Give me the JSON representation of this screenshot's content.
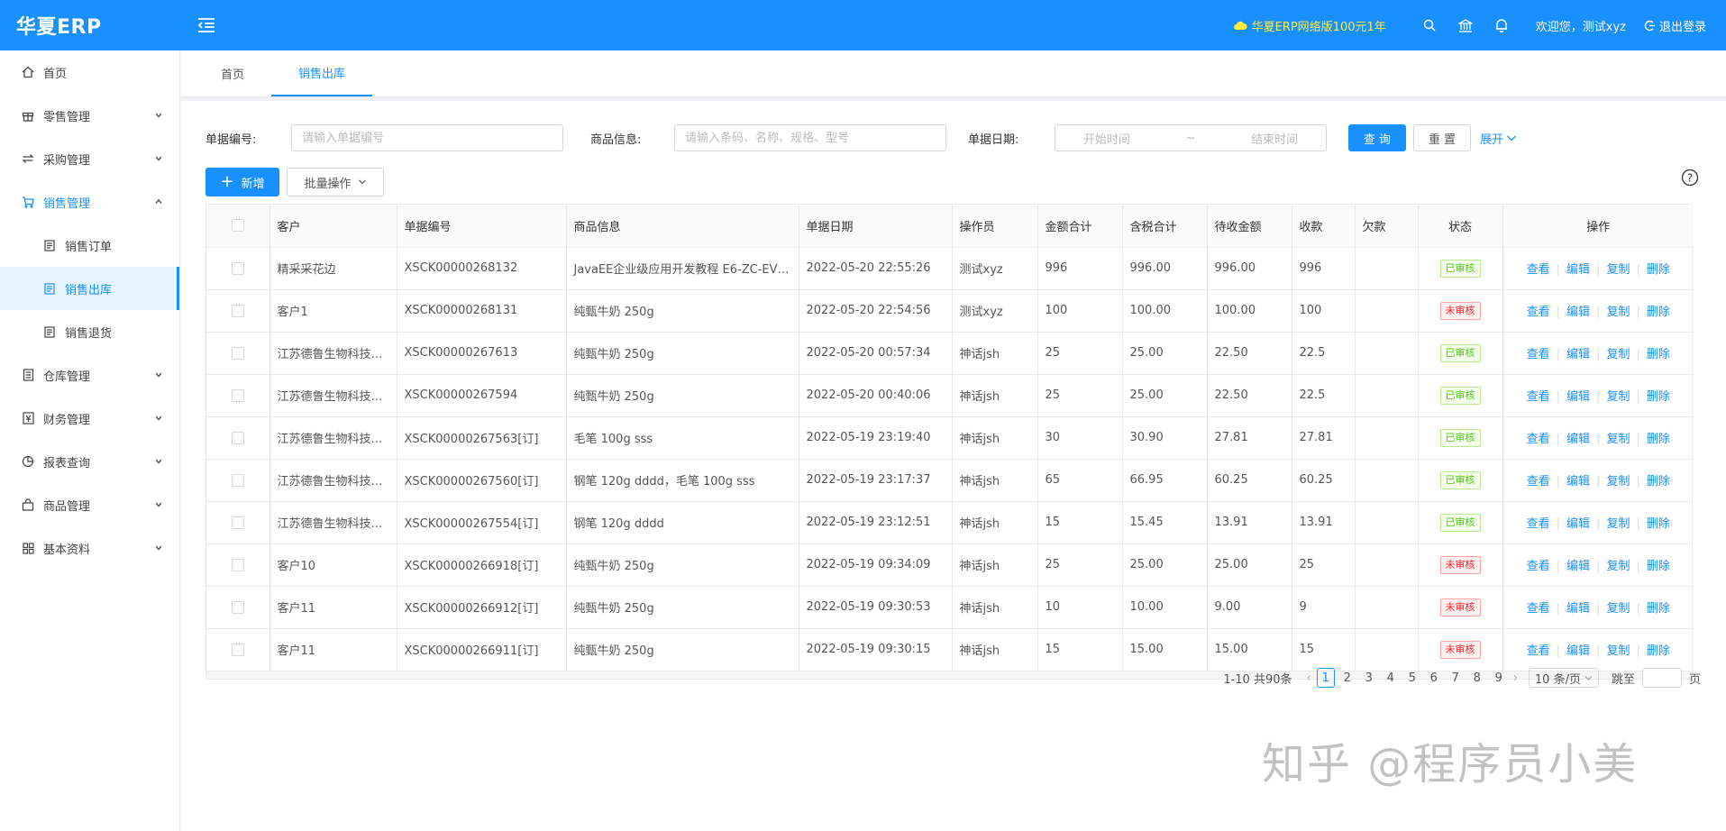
{
  "header": {
    "logo": "华夏ERP",
    "promo": "华夏ERP网络版100元1年",
    "welcome": "欢迎您，测试xyz",
    "logout": "退出登录"
  },
  "sidebar": {
    "items": [
      {
        "label": "首页",
        "icon": "home-icon"
      },
      {
        "label": "零售管理",
        "icon": "gift-icon"
      },
      {
        "label": "采购管理",
        "icon": "swap-icon"
      },
      {
        "label": "销售管理",
        "icon": "cart-icon"
      },
      {
        "label": "销售订单",
        "icon": "doc-icon"
      },
      {
        "label": "销售出库",
        "icon": "doc-icon"
      },
      {
        "label": "销售退货",
        "icon": "doc-icon"
      },
      {
        "label": "仓库管理",
        "icon": "warehouse-icon"
      },
      {
        "label": "财务管理",
        "icon": "finance-icon"
      },
      {
        "label": "报表查询",
        "icon": "pie-icon"
      },
      {
        "label": "商品管理",
        "icon": "shop-icon"
      },
      {
        "label": "基本资料",
        "icon": "grid-icon"
      }
    ]
  },
  "tabs": [
    "首页",
    "销售出库"
  ],
  "search": {
    "bill_no_label": "单据编号:",
    "bill_no_placeholder": "请输入单据编号",
    "goods_label": "商品信息:",
    "goods_placeholder": "请输入条码、名称、规格、型号",
    "date_label": "单据日期:",
    "start_placeholder": "开始时间",
    "range_sep": "~",
    "end_placeholder": "结束时间",
    "query_btn": "查 询",
    "reset_btn": "重 置",
    "expand": "展开"
  },
  "toolbar": {
    "add_btn": "新增",
    "batch_btn": "批量操作"
  },
  "table": {
    "columns": [
      "客户",
      "单据编号",
      "商品信息",
      "单据日期",
      "操作员",
      "金额合计",
      "含税合计",
      "待收金额",
      "收款",
      "欠款",
      "状态",
      "操作"
    ],
    "ops": [
      "查看",
      "编辑",
      "复制",
      "删除"
    ],
    "rows": [
      {
        "customer": "精采采花边",
        "no": "XSCK00000268132",
        "goods": "JavaEE企业级应用开发教程 E6-ZC-EV…",
        "date": "2022-05-20 22:55:26",
        "op": "测试xyz",
        "amount": "996",
        "tax": "996.00",
        "pending": "996.00",
        "paid": "996",
        "debt": "",
        "status": "已审核",
        "ok": true
      },
      {
        "customer": "客户1",
        "no": "XSCK00000268131",
        "goods": "纯甄牛奶 250g",
        "date": "2022-05-20 22:54:56",
        "op": "测试xyz",
        "amount": "100",
        "tax": "100.00",
        "pending": "100.00",
        "paid": "100",
        "debt": "",
        "status": "未审核",
        "ok": false
      },
      {
        "customer": "江苏德鲁生物科技…",
        "no": "XSCK00000267613",
        "goods": "纯甄牛奶 250g",
        "date": "2022-05-20 00:57:34",
        "op": "神话jsh",
        "amount": "25",
        "tax": "25.00",
        "pending": "22.50",
        "paid": "22.5",
        "debt": "",
        "status": "已审核",
        "ok": true
      },
      {
        "customer": "江苏德鲁生物科技…",
        "no": "XSCK00000267594",
        "goods": "纯甄牛奶 250g",
        "date": "2022-05-20 00:40:06",
        "op": "神话jsh",
        "amount": "25",
        "tax": "25.00",
        "pending": "22.50",
        "paid": "22.5",
        "debt": "",
        "status": "已审核",
        "ok": true
      },
      {
        "customer": "江苏德鲁生物科技…",
        "no": "XSCK00000267563[订]",
        "goods": "毛笔 100g sss",
        "date": "2022-05-19 23:19:40",
        "op": "神话jsh",
        "amount": "30",
        "tax": "30.90",
        "pending": "27.81",
        "paid": "27.81",
        "debt": "",
        "status": "已审核",
        "ok": true
      },
      {
        "customer": "江苏德鲁生物科技…",
        "no": "XSCK00000267560[订]",
        "goods": "钢笔 120g dddd，毛笔 100g sss",
        "date": "2022-05-19 23:17:37",
        "op": "神话jsh",
        "amount": "65",
        "tax": "66.95",
        "pending": "60.25",
        "paid": "60.25",
        "debt": "",
        "status": "已审核",
        "ok": true
      },
      {
        "customer": "江苏德鲁生物科技…",
        "no": "XSCK00000267554[订]",
        "goods": "钢笔 120g dddd",
        "date": "2022-05-19 23:12:51",
        "op": "神话jsh",
        "amount": "15",
        "tax": "15.45",
        "pending": "13.91",
        "paid": "13.91",
        "debt": "",
        "status": "已审核",
        "ok": true
      },
      {
        "customer": "客户10",
        "no": "XSCK00000266918[订]",
        "goods": "纯甄牛奶 250g",
        "date": "2022-05-19 09:34:09",
        "op": "神话jsh",
        "amount": "25",
        "tax": "25.00",
        "pending": "25.00",
        "paid": "25",
        "debt": "",
        "status": "未审核",
        "ok": false
      },
      {
        "customer": "客户11",
        "no": "XSCK00000266912[订]",
        "goods": "纯甄牛奶 250g",
        "date": "2022-05-19 09:30:53",
        "op": "神话jsh",
        "amount": "10",
        "tax": "10.00",
        "pending": "9.00",
        "paid": "9",
        "debt": "",
        "status": "未审核",
        "ok": false
      },
      {
        "customer": "客户11",
        "no": "XSCK00000266911[订]",
        "goods": "纯甄牛奶 250g",
        "date": "2022-05-19 09:30:15",
        "op": "神话jsh",
        "amount": "15",
        "tax": "15.00",
        "pending": "15.00",
        "paid": "15",
        "debt": "",
        "status": "未审核",
        "ok": false
      }
    ]
  },
  "pagination": {
    "summary": "1-10 共90条",
    "pages": [
      "1",
      "2",
      "3",
      "4",
      "5",
      "6",
      "7",
      "8",
      "9"
    ],
    "current": "1",
    "size": "10 条/页",
    "jump_label": "跳至",
    "page_suffix": "页"
  },
  "watermark": "知乎 @程序员小美",
  "colors": {
    "primary": "#1890ff",
    "ok": "#52c41a",
    "no": "#f5222d",
    "promo": "#ffec3d"
  }
}
